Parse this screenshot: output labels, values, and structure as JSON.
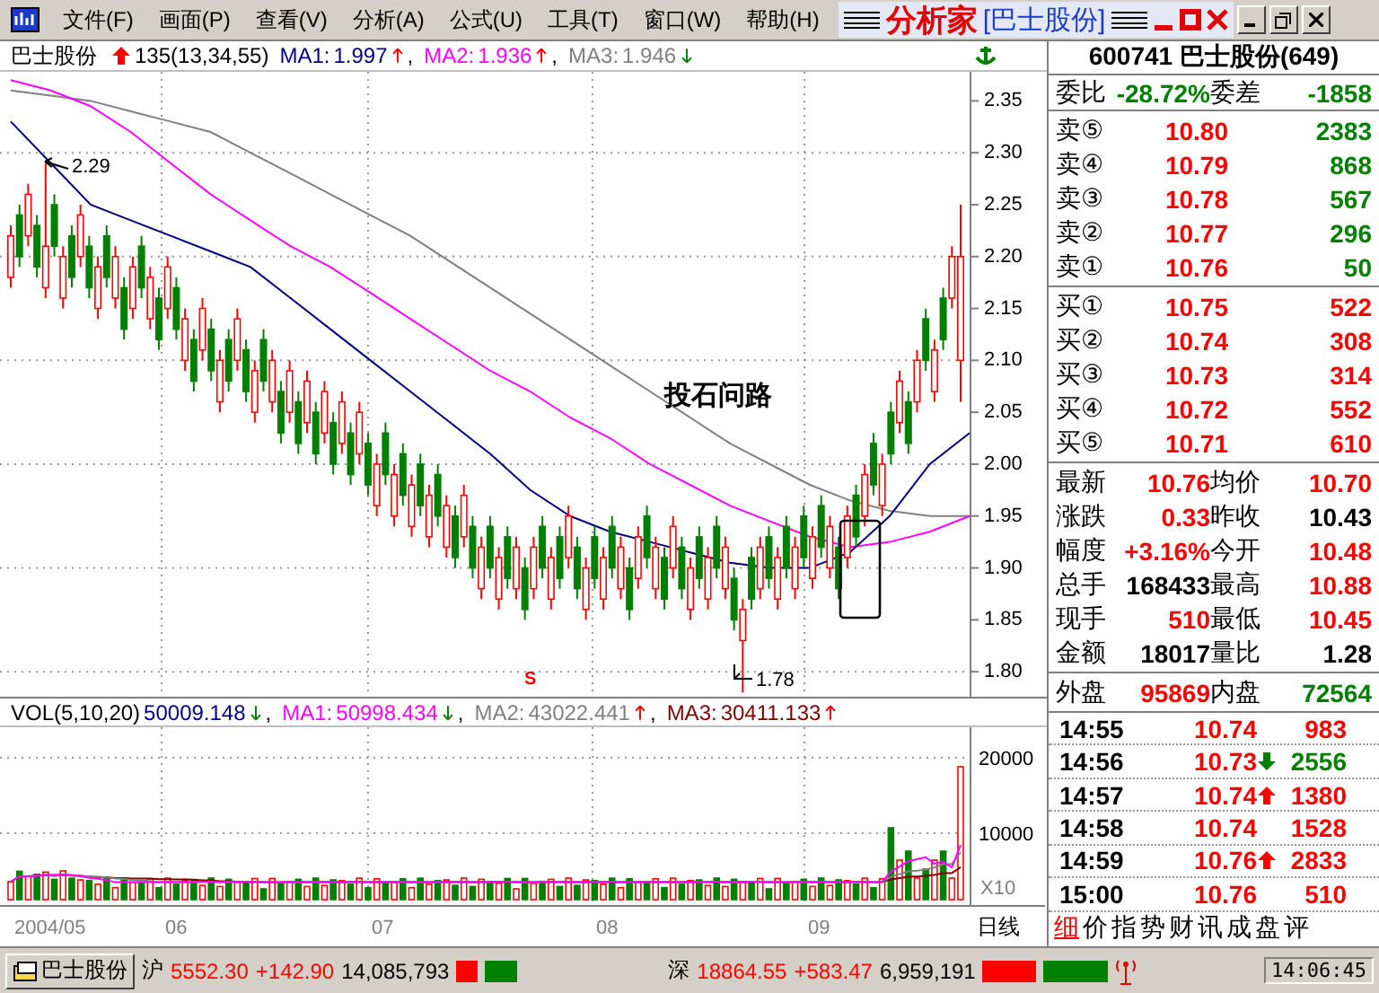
{
  "menu_bar": {
    "items": [
      "文件(F)",
      "画面(P)",
      "查看(V)",
      "分析(A)",
      "公式(U)",
      "工具(T)",
      "窗口(W)",
      "帮助(H)"
    ],
    "app_title": "分析家",
    "app_document": "[巴士股份]"
  },
  "chart_header": {
    "stock": "巴士股份",
    "formula": "135(13,34,55)",
    "indicators": [
      {
        "label": "MA1:",
        "value": "1.997",
        "rising": true,
        "color": "#000080",
        "suffix": ","
      },
      {
        "label": "MA2:",
        "value": "1.936",
        "rising": true,
        "color": "#ff00ff",
        "suffix": ","
      },
      {
        "label": "MA3:",
        "value": "1.946",
        "rising": false,
        "color": "#808080"
      }
    ]
  },
  "price_chart": {
    "annotations": {
      "high_label": "2.29",
      "low_label": "1.78",
      "note": "投石问路",
      "signal": "S"
    },
    "chart_data": {
      "type": "candlestick",
      "categories": [
        null,
        null,
        null,
        null,
        null,
        null,
        null,
        null,
        null,
        null,
        null,
        null,
        null,
        null,
        null,
        null,
        null,
        null,
        null,
        null,
        null,
        null,
        null,
        null,
        null,
        null,
        null,
        null,
        null,
        null,
        null,
        null,
        null,
        null,
        null,
        null,
        null,
        null,
        null,
        null,
        null,
        null,
        null,
        null,
        null,
        null,
        null,
        null,
        null,
        null,
        null,
        null,
        null,
        null,
        null,
        null,
        null,
        null,
        null,
        null,
        null,
        null,
        null,
        null,
        null,
        null,
        null,
        null,
        null,
        null,
        null,
        null,
        null,
        null,
        null,
        null,
        null,
        null,
        null,
        null,
        null,
        null,
        null,
        null,
        null,
        null,
        null,
        null,
        null,
        null,
        null,
        null,
        null,
        null,
        null,
        null,
        null,
        null,
        null,
        null,
        null,
        null,
        null,
        null,
        null,
        null,
        null,
        null,
        null,
        null
      ],
      "ylim": [
        1.769,
        2.378
      ],
      "yticks": [
        {
          "value": 2.35,
          "label": "2.35"
        },
        {
          "value": 2.3,
          "label": "2.30"
        },
        {
          "value": 2.25,
          "label": "2.25"
        },
        {
          "value": 2.2,
          "label": "2.20"
        },
        {
          "value": 2.15,
          "label": "2.15"
        },
        {
          "value": 2.1,
          "label": "2.10"
        },
        {
          "value": 2.05,
          "label": "2.05"
        },
        {
          "value": 2.0,
          "label": "2.00"
        },
        {
          "value": 1.95,
          "label": "1.95"
        },
        {
          "value": 1.9,
          "label": "1.90"
        },
        {
          "value": 1.85,
          "label": "1.85"
        },
        {
          "value": 1.8,
          "label": "1.80"
        }
      ],
      "ohlc": [
        [
          2.18,
          2.23,
          2.17,
          2.22
        ],
        [
          2.24,
          2.25,
          2.19,
          2.2
        ],
        [
          2.22,
          2.27,
          2.21,
          2.26
        ],
        [
          2.23,
          2.24,
          2.18,
          2.19
        ],
        [
          2.17,
          2.29,
          2.16,
          2.21
        ],
        [
          2.25,
          2.26,
          2.2,
          2.21
        ],
        [
          2.16,
          2.21,
          2.15,
          2.2
        ],
        [
          2.22,
          2.23,
          2.17,
          2.18
        ],
        [
          2.2,
          2.25,
          2.19,
          2.24
        ],
        [
          2.21,
          2.22,
          2.16,
          2.17
        ],
        [
          2.15,
          2.2,
          2.14,
          2.19
        ],
        [
          2.22,
          2.23,
          2.17,
          2.18
        ],
        [
          2.16,
          2.21,
          2.15,
          2.2
        ],
        [
          2.17,
          2.18,
          2.12,
          2.13
        ],
        [
          2.15,
          2.2,
          2.14,
          2.19
        ],
        [
          2.21,
          2.22,
          2.16,
          2.17
        ],
        [
          2.14,
          2.19,
          2.13,
          2.18
        ],
        [
          2.16,
          2.17,
          2.11,
          2.12
        ],
        [
          2.15,
          2.2,
          2.14,
          2.19
        ],
        [
          2.17,
          2.18,
          2.12,
          2.13
        ],
        [
          2.1,
          2.15,
          2.09,
          2.14
        ],
        [
          2.12,
          2.13,
          2.07,
          2.08
        ],
        [
          2.11,
          2.16,
          2.1,
          2.15
        ],
        [
          2.13,
          2.14,
          2.08,
          2.09
        ],
        [
          2.06,
          2.11,
          2.05,
          2.1
        ],
        [
          2.12,
          2.13,
          2.07,
          2.08
        ],
        [
          2.1,
          2.15,
          2.09,
          2.14
        ],
        [
          2.11,
          2.12,
          2.06,
          2.07
        ],
        [
          2.05,
          2.1,
          2.04,
          2.09
        ],
        [
          2.12,
          2.13,
          2.07,
          2.08
        ],
        [
          2.06,
          2.11,
          2.05,
          2.1
        ],
        [
          2.07,
          2.08,
          2.02,
          2.03
        ],
        [
          2.05,
          2.1,
          2.04,
          2.09
        ],
        [
          2.06,
          2.07,
          2.01,
          2.02
        ],
        [
          2.04,
          2.09,
          2.03,
          2.08
        ],
        [
          2.05,
          2.06,
          2.0,
          2.01
        ],
        [
          2.03,
          2.08,
          2.02,
          2.07
        ],
        [
          2.04,
          2.05,
          1.99,
          2.0
        ],
        [
          2.02,
          2.07,
          2.01,
          2.06
        ],
        [
          2.03,
          2.04,
          1.98,
          1.99
        ],
        [
          2.01,
          2.06,
          2.0,
          2.05
        ],
        [
          2.02,
          2.03,
          1.97,
          1.98
        ],
        [
          1.96,
          2.01,
          1.95,
          2.0
        ],
        [
          2.03,
          2.04,
          1.98,
          1.99
        ],
        [
          1.95,
          2.0,
          1.94,
          1.99
        ],
        [
          2.01,
          2.02,
          1.96,
          1.97
        ],
        [
          1.94,
          1.99,
          1.93,
          1.98
        ],
        [
          2.0,
          2.01,
          1.95,
          1.96
        ],
        [
          1.93,
          1.98,
          1.92,
          1.97
        ],
        [
          1.99,
          2.0,
          1.94,
          1.95
        ],
        [
          1.92,
          1.97,
          1.91,
          1.96
        ],
        [
          1.95,
          1.96,
          1.9,
          1.91
        ],
        [
          1.93,
          1.98,
          1.92,
          1.97
        ],
        [
          1.94,
          1.95,
          1.89,
          1.9
        ],
        [
          1.88,
          1.93,
          1.87,
          1.92
        ],
        [
          1.94,
          1.95,
          1.89,
          1.9
        ],
        [
          1.87,
          1.92,
          1.86,
          1.91
        ],
        [
          1.93,
          1.94,
          1.88,
          1.89
        ],
        [
          1.88,
          1.93,
          1.87,
          1.92
        ],
        [
          1.9,
          1.91,
          1.85,
          1.86
        ],
        [
          1.88,
          1.93,
          1.87,
          1.92
        ],
        [
          1.94,
          1.95,
          1.89,
          1.9
        ],
        [
          1.87,
          1.92,
          1.86,
          1.91
        ],
        [
          1.93,
          1.94,
          1.88,
          1.89
        ],
        [
          1.91,
          1.96,
          1.9,
          1.95
        ],
        [
          1.92,
          1.93,
          1.87,
          1.88
        ],
        [
          1.86,
          1.91,
          1.85,
          1.9
        ],
        [
          1.93,
          1.94,
          1.88,
          1.89
        ],
        [
          1.87,
          1.92,
          1.86,
          1.91
        ],
        [
          1.94,
          1.95,
          1.89,
          1.9
        ],
        [
          1.88,
          1.93,
          1.87,
          1.92
        ],
        [
          1.9,
          1.91,
          1.85,
          1.86
        ],
        [
          1.89,
          1.94,
          1.88,
          1.93
        ],
        [
          1.95,
          1.96,
          1.9,
          1.91
        ],
        [
          1.88,
          1.93,
          1.87,
          1.92
        ],
        [
          1.91,
          1.92,
          1.86,
          1.87
        ],
        [
          1.9,
          1.95,
          1.89,
          1.94
        ],
        [
          1.92,
          1.93,
          1.87,
          1.88
        ],
        [
          1.86,
          1.91,
          1.85,
          1.9
        ],
        [
          1.93,
          1.94,
          1.88,
          1.89
        ],
        [
          1.87,
          1.92,
          1.86,
          1.91
        ],
        [
          1.94,
          1.95,
          1.89,
          1.9
        ],
        [
          1.88,
          1.93,
          1.87,
          1.92
        ],
        [
          1.89,
          1.9,
          1.84,
          1.85
        ],
        [
          1.83,
          1.87,
          1.78,
          1.86
        ],
        [
          1.91,
          1.92,
          1.86,
          1.87
        ],
        [
          1.88,
          1.93,
          1.87,
          1.92
        ],
        [
          1.93,
          1.94,
          1.88,
          1.89
        ],
        [
          1.87,
          1.92,
          1.86,
          1.91
        ],
        [
          1.94,
          1.95,
          1.89,
          1.9
        ],
        [
          1.88,
          1.93,
          1.87,
          1.92
        ],
        [
          1.95,
          1.96,
          1.9,
          1.91
        ],
        [
          1.89,
          1.94,
          1.88,
          1.93
        ],
        [
          1.96,
          1.97,
          1.91,
          1.92
        ],
        [
          1.9,
          1.95,
          1.89,
          1.94
        ],
        [
          1.92,
          1.93,
          1.87,
          1.88
        ],
        [
          1.91,
          1.96,
          1.9,
          1.95
        ],
        [
          1.97,
          1.98,
          1.92,
          1.93
        ],
        [
          1.95,
          2.0,
          1.94,
          1.99
        ],
        [
          2.02,
          2.03,
          1.97,
          1.98
        ],
        [
          1.96,
          2.01,
          1.95,
          2.0
        ],
        [
          2.05,
          2.06,
          2.0,
          2.01
        ],
        [
          2.04,
          2.09,
          2.03,
          2.08
        ],
        [
          2.06,
          2.07,
          2.01,
          2.02
        ],
        [
          2.06,
          2.11,
          2.05,
          2.1
        ],
        [
          2.14,
          2.15,
          2.09,
          2.1
        ],
        [
          2.07,
          2.12,
          2.06,
          2.11
        ],
        [
          2.16,
          2.17,
          2.11,
          2.12
        ],
        [
          2.16,
          2.21,
          2.15,
          2.2
        ],
        [
          2.1,
          2.25,
          2.06,
          2.2
        ]
      ]
    },
    "moving_averages": {
      "chart_data": {
        "type": "line",
        "categories": [
          null,
          null,
          null,
          null,
          null,
          null,
          null,
          null,
          null,
          null,
          null,
          null,
          null,
          null,
          null,
          null,
          null,
          null,
          null,
          null,
          null,
          null,
          null,
          null,
          null
        ],
        "ylim": [
          1.769,
          2.378
        ],
        "series": [
          {
            "color": "#000080",
            "values": [
              2.33,
              2.29,
              2.25,
              2.235,
              2.22,
              2.205,
              2.19,
              2.16,
              2.13,
              2.1,
              2.07,
              2.04,
              2.01,
              1.975,
              1.95,
              1.935,
              1.925,
              1.915,
              1.905,
              1.9,
              1.9,
              1.915,
              1.95,
              2.0,
              2.03
            ]
          },
          {
            "color": "#ff00ff",
            "values": [
              2.37,
              2.36,
              2.345,
              2.32,
              2.29,
              2.26,
              2.235,
              2.21,
              2.19,
              2.165,
              2.14,
              2.115,
              2.09,
              2.07,
              2.045,
              2.025,
              2.0,
              1.98,
              1.96,
              1.945,
              1.93,
              1.92,
              1.925,
              1.935,
              1.95
            ]
          },
          {
            "color": "#808080",
            "values": [
              2.36,
              2.355,
              2.35,
              2.34,
              2.33,
              2.32,
              2.3,
              2.28,
              2.26,
              2.24,
              2.22,
              2.195,
              2.17,
              2.145,
              2.12,
              2.095,
              2.07,
              2.045,
              2.02,
              2.0,
              1.98,
              1.965,
              1.955,
              1.95,
              1.95
            ]
          }
        ]
      }
    }
  },
  "volume_header": {
    "title": "VOL(5,10,20)",
    "indicators": [
      {
        "value": "50009.148",
        "rising": false,
        "color": "#000080",
        "suffix": ","
      },
      {
        "label": "MA1:",
        "value": "50998.434",
        "rising": false,
        "color": "#ff00ff",
        "suffix": ","
      },
      {
        "label": "MA2:",
        "value": "43022.441",
        "rising": true,
        "color": "#808080",
        "suffix": ","
      },
      {
        "label": "MA3:",
        "value": "30411.133",
        "rising": true,
        "color": "#800000"
      }
    ]
  },
  "volume_axis": {
    "ticks": [
      "20000",
      "10000"
    ],
    "unit": "X10"
  },
  "x_axis": {
    "labels": [
      "2004/05",
      "06",
      "07",
      "08",
      "09"
    ],
    "period": "日线"
  },
  "quote": {
    "title": "600741 巴士股份(649)",
    "ratio": [
      {
        "text": "委比"
      },
      {
        "text": "-28.72%",
        "color": "#008000"
      },
      {
        "text": "委差"
      },
      {
        "text": "-1858",
        "color": "#008000"
      }
    ],
    "asks": [
      {
        "label": "卖⑤",
        "price": {
          "text": "10.80",
          "color": "#ff0000"
        },
        "volume": {
          "text": "2383",
          "color": "#008000"
        }
      },
      {
        "label": "卖④",
        "price": {
          "text": "10.79",
          "color": "#ff0000"
        },
        "volume": {
          "text": "868",
          "color": "#008000"
        }
      },
      {
        "label": "卖③",
        "price": {
          "text": "10.78",
          "color": "#ff0000"
        },
        "volume": {
          "text": "567",
          "color": "#008000"
        }
      },
      {
        "label": "卖②",
        "price": {
          "text": "10.77",
          "color": "#ff0000"
        },
        "volume": {
          "text": "296",
          "color": "#008000"
        }
      },
      {
        "label": "卖①",
        "price": {
          "text": "10.76",
          "color": "#ff0000"
        },
        "volume": {
          "text": "50",
          "color": "#008000"
        }
      }
    ],
    "bids": [
      {
        "label": "买①",
        "price": {
          "text": "10.75",
          "color": "#ff0000"
        },
        "volume": {
          "text": "522",
          "color": "#ff0000"
        }
      },
      {
        "label": "买②",
        "price": {
          "text": "10.74",
          "color": "#ff0000"
        },
        "volume": {
          "text": "308",
          "color": "#ff0000"
        }
      },
      {
        "label": "买③",
        "price": {
          "text": "10.73",
          "color": "#ff0000"
        },
        "volume": {
          "text": "314",
          "color": "#ff0000"
        }
      },
      {
        "label": "买④",
        "price": {
          "text": "10.72",
          "color": "#ff0000"
        },
        "volume": {
          "text": "552",
          "color": "#ff0000"
        }
      },
      {
        "label": "买⑤",
        "price": {
          "text": "10.71",
          "color": "#ff0000"
        },
        "volume": {
          "text": "610",
          "color": "#ff0000"
        }
      }
    ],
    "stats": [
      [
        {
          "text": "最新"
        },
        {
          "text": "10.76",
          "color": "#ff0000"
        },
        {
          "text": "均价"
        },
        {
          "text": "10.70",
          "color": "#ff0000"
        }
      ],
      [
        {
          "text": "涨跌"
        },
        {
          "text": "0.33",
          "color": "#ff0000"
        },
        {
          "text": "昨收"
        },
        {
          "text": "10.43",
          "color": "#000000"
        }
      ],
      [
        {
          "text": "幅度"
        },
        {
          "text": "+3.16%",
          "color": "#ff0000"
        },
        {
          "text": "今开"
        },
        {
          "text": "10.48",
          "color": "#ff0000"
        }
      ],
      [
        {
          "text": "总手"
        },
        {
          "text": "168433",
          "color": "#000000"
        },
        {
          "text": "最高"
        },
        {
          "text": "10.88",
          "color": "#ff0000"
        }
      ],
      [
        {
          "text": "现手"
        },
        {
          "text": "510",
          "color": "#ff0000"
        },
        {
          "text": "最低"
        },
        {
          "text": "10.45",
          "color": "#ff0000"
        }
      ],
      [
        {
          "text": "金额"
        },
        {
          "text": "18017",
          "color": "#000000"
        },
        {
          "text": "量比"
        },
        {
          "text": "1.28",
          "color": "#000000"
        }
      ]
    ],
    "outer": [
      {
        "text": "外盘"
      },
      {
        "text": "95869",
        "color": "#ff0000"
      },
      {
        "text": "内盘"
      },
      {
        "text": "72564",
        "color": "#008000"
      }
    ]
  },
  "ticks": [
    {
      "time": "14:55",
      "price": "10.74",
      "up_arrow": false,
      "down_arrow": false,
      "volume": {
        "text": "983",
        "color": "#ff0000"
      }
    },
    {
      "time": "14:56",
      "price": "10.73",
      "up_arrow": false,
      "down_arrow": true,
      "volume": {
        "text": "2556",
        "color": "#008000"
      }
    },
    {
      "time": "14:57",
      "price": "10.74",
      "up_arrow": true,
      "down_arrow": false,
      "volume": {
        "text": "1380",
        "color": "#ff0000"
      }
    },
    {
      "time": "14:58",
      "price": "10.74",
      "up_arrow": false,
      "down_arrow": false,
      "volume": {
        "text": "1528",
        "color": "#ff0000"
      }
    },
    {
      "time": "14:59",
      "price": "10.76",
      "up_arrow": true,
      "down_arrow": false,
      "volume": {
        "text": "2833",
        "color": "#ff0000"
      }
    },
    {
      "time": "15:00",
      "price": "10.76",
      "up_arrow": false,
      "down_arrow": false,
      "volume": {
        "text": "510",
        "color": "#ff0000"
      }
    }
  ],
  "panel_tabs": [
    {
      "label": "细",
      "selected": true
    },
    {
      "label": "价",
      "selected": false
    },
    {
      "label": "指",
      "selected": false
    },
    {
      "label": "势",
      "selected": false
    },
    {
      "label": "财",
      "selected": false
    },
    {
      "label": "讯",
      "selected": false
    },
    {
      "label": "成",
      "selected": false
    },
    {
      "label": "盘",
      "selected": false
    },
    {
      "label": "评",
      "selected": false
    }
  ],
  "status_bar": {
    "button": "巴士股份",
    "markets": [
      {
        "label": "沪",
        "index": "5552.30",
        "change": "+142.90",
        "volume": "14,085,793"
      },
      {
        "label": "深",
        "index": "18864.55",
        "change": "+583.47",
        "volume": "6,959,191"
      }
    ],
    "time": "14:06:45"
  }
}
